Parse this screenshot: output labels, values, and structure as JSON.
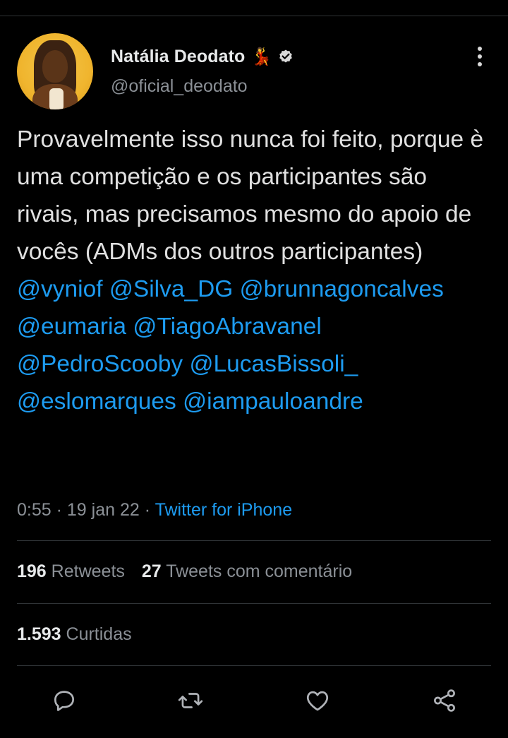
{
  "author": {
    "display_name": "Natália Deodato",
    "handle": "@oficial_deodato",
    "name_emoji": "💃",
    "verified": true
  },
  "tweet": {
    "text_plain": "Provavelmente isso nunca foi feito, porque è uma competição e os participantes são rivais, mas precisamos mesmo do apoio de vocês (ADMs dos outros participantes) ",
    "mentions": [
      "@vyniof",
      "@Silva_DG",
      "@brunnagoncalves",
      "@eumaria",
      "@TiagoAbravanel",
      "@PedroScooby",
      "@LucasBissoli_",
      "@eslomarques",
      "@iampauloandre"
    ],
    "time": "0:55",
    "date": "19 jan 22",
    "source": "Twitter for iPhone"
  },
  "stats": {
    "retweets_count": "196",
    "retweets_label": "Retweets",
    "quotes_count": "27",
    "quotes_label": "Tweets com comentário",
    "likes_count": "1.593",
    "likes_label": "Curtidas"
  },
  "actions": [
    {
      "icon": "reply-icon"
    },
    {
      "icon": "retweet-icon"
    },
    {
      "icon": "like-icon"
    },
    {
      "icon": "share-icon"
    }
  ],
  "colors": {
    "background": "#000000",
    "text": "#e0e0e0",
    "secondary": "#8b9096",
    "link": "#1d9bf0",
    "divider": "#2f3336"
  }
}
